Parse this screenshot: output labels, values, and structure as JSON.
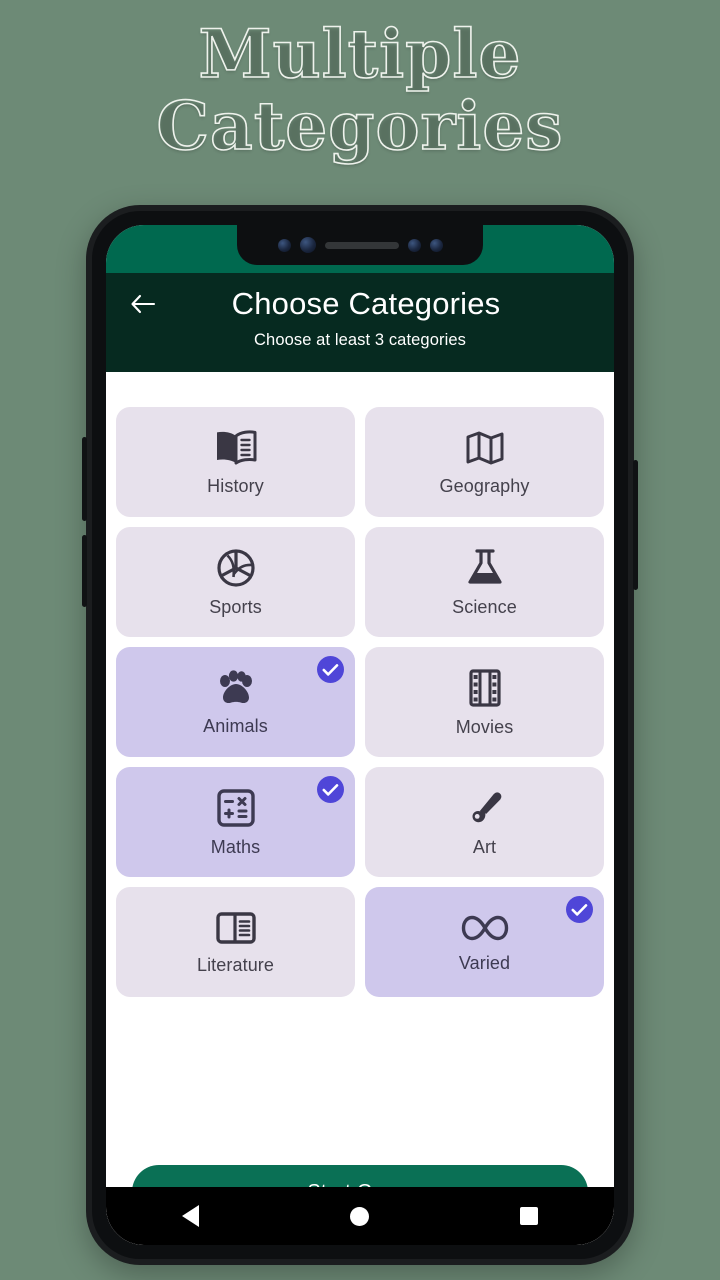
{
  "promo": {
    "line1": "Multiple",
    "line2": "Categories"
  },
  "colors": {
    "page_background": "#6d8a76",
    "statusbar_green": "#00694f",
    "appbar_green": "#062a20",
    "tile_unselected": "#e7e1ec",
    "tile_selected": "#cfc8ec",
    "check_badge": "#4f46d8",
    "start_button": "#0a7055",
    "icon_dark": "#3a3744"
  },
  "appbar": {
    "back_icon": "arrow-left-icon",
    "title": "Choose Categories",
    "subtitle": "Choose at least 3 categories"
  },
  "categories": [
    {
      "label": "History",
      "icon": "open-book-icon",
      "selected": false
    },
    {
      "label": "Geography",
      "icon": "map-icon",
      "selected": false
    },
    {
      "label": "Sports",
      "icon": "volleyball-icon",
      "selected": false
    },
    {
      "label": "Science",
      "icon": "flask-icon",
      "selected": false
    },
    {
      "label": "Animals",
      "icon": "paw-icon",
      "selected": true
    },
    {
      "label": "Movies",
      "icon": "film-strip-icon",
      "selected": false
    },
    {
      "label": "Maths",
      "icon": "calculator-icon",
      "selected": true
    },
    {
      "label": "Art",
      "icon": "paintbrush-icon",
      "selected": false
    },
    {
      "label": "Literature",
      "icon": "article-icon",
      "selected": false
    },
    {
      "label": "Varied",
      "icon": "infinity-icon",
      "selected": true
    }
  ],
  "footer": {
    "start_label": "Start Game"
  },
  "navbar": {
    "back": "nav-back-icon",
    "home": "nav-home-icon",
    "recent": "nav-recents-icon"
  }
}
